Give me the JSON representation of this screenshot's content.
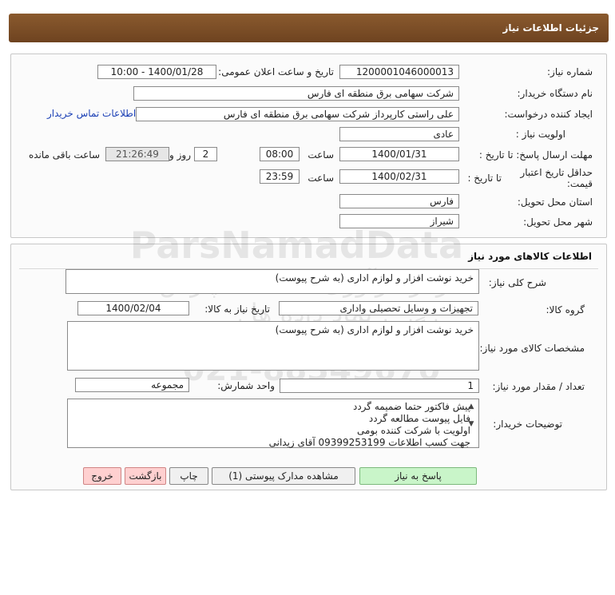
{
  "header": {
    "title": "جزئیات اطلاعات نیاز"
  },
  "info": {
    "need_number_label": "شماره نیاز:",
    "need_number": "1200001046000013",
    "announce_label": "تاریخ و ساعت اعلان عمومی:",
    "announce_value": "1400/01/28 - 10:00",
    "buyer_org_label": "نام دستگاه خریدار:",
    "buyer_org": "شرکت سهامی برق منطقه ای فارس",
    "requester_label": "ایجاد کننده درخواست:",
    "requester": "علی راستی کارپرداز شرکت سهامی برق منطقه ای فارس",
    "contact_link": "اطلاعات تماس خریدار",
    "priority_label": "اولویت نیاز :",
    "priority": "عادی",
    "deadline_label": "مهلت ارسال پاسخ: تا تاریخ :",
    "deadline_date": "1400/01/31",
    "time_label": "ساعت",
    "deadline_time": "08:00",
    "days_value": "2",
    "days_label": "روز و",
    "remaining_time": "21:26:49",
    "remaining_label": "ساعت باقی مانده",
    "min_validity_label": "حداقل تاریخ اعتبار قیمت:",
    "until_date_label": "تا تاریخ :",
    "validity_date": "1400/02/31",
    "validity_time_label": "ساعت",
    "validity_time": "23:59",
    "province_label": "استان محل تحویل:",
    "province": "فارس",
    "city_label": "شهر محل تحویل:",
    "city": "شیراز"
  },
  "goods": {
    "section_title": "اطلاعات کالاهای مورد نیاز",
    "general_desc_label": "شرح کلی نیاز:",
    "general_desc": "خرید نوشت افزار و لوازم اداری (به شرح پیوست)",
    "group_label": "گروه کالا:",
    "group": "تجهیزات و وسایل تحصیلی واداری",
    "need_date_label": "تاریخ نیاز به کالا:",
    "need_date": "1400/02/04",
    "spec_label": "مشخصات کالای مورد نیاز:",
    "spec": "خرید نوشت افزار و لوازم اداری (به شرح پیوست)",
    "qty_label": "تعداد / مقدار مورد نیاز:",
    "qty": "1",
    "unit_label": "واحد شمارش:",
    "unit": "مجموعه",
    "buyer_notes_label": "توضیحات خریدار:",
    "buyer_notes": [
      "پیش فاکتور حتما ضمیمه گردد",
      "فایل پیوست مطالعه گردد",
      "اولویت با شرکت کننده بومی",
      "جهت کسب اطلاعات 09399253199 آقای زیدانی"
    ]
  },
  "buttons": {
    "reply": "پاسخ به نیاز",
    "attachments": "مشاهده مدارک پیوستی (1)",
    "print": "چاپ",
    "back": "بازگشت",
    "exit": "خروج"
  },
  "colors": {
    "header_bg": "#7a4c25",
    "reply_btn": "#c9f5c9",
    "back_btn": "#ffd0d0",
    "link": "#1a3fb5"
  }
}
